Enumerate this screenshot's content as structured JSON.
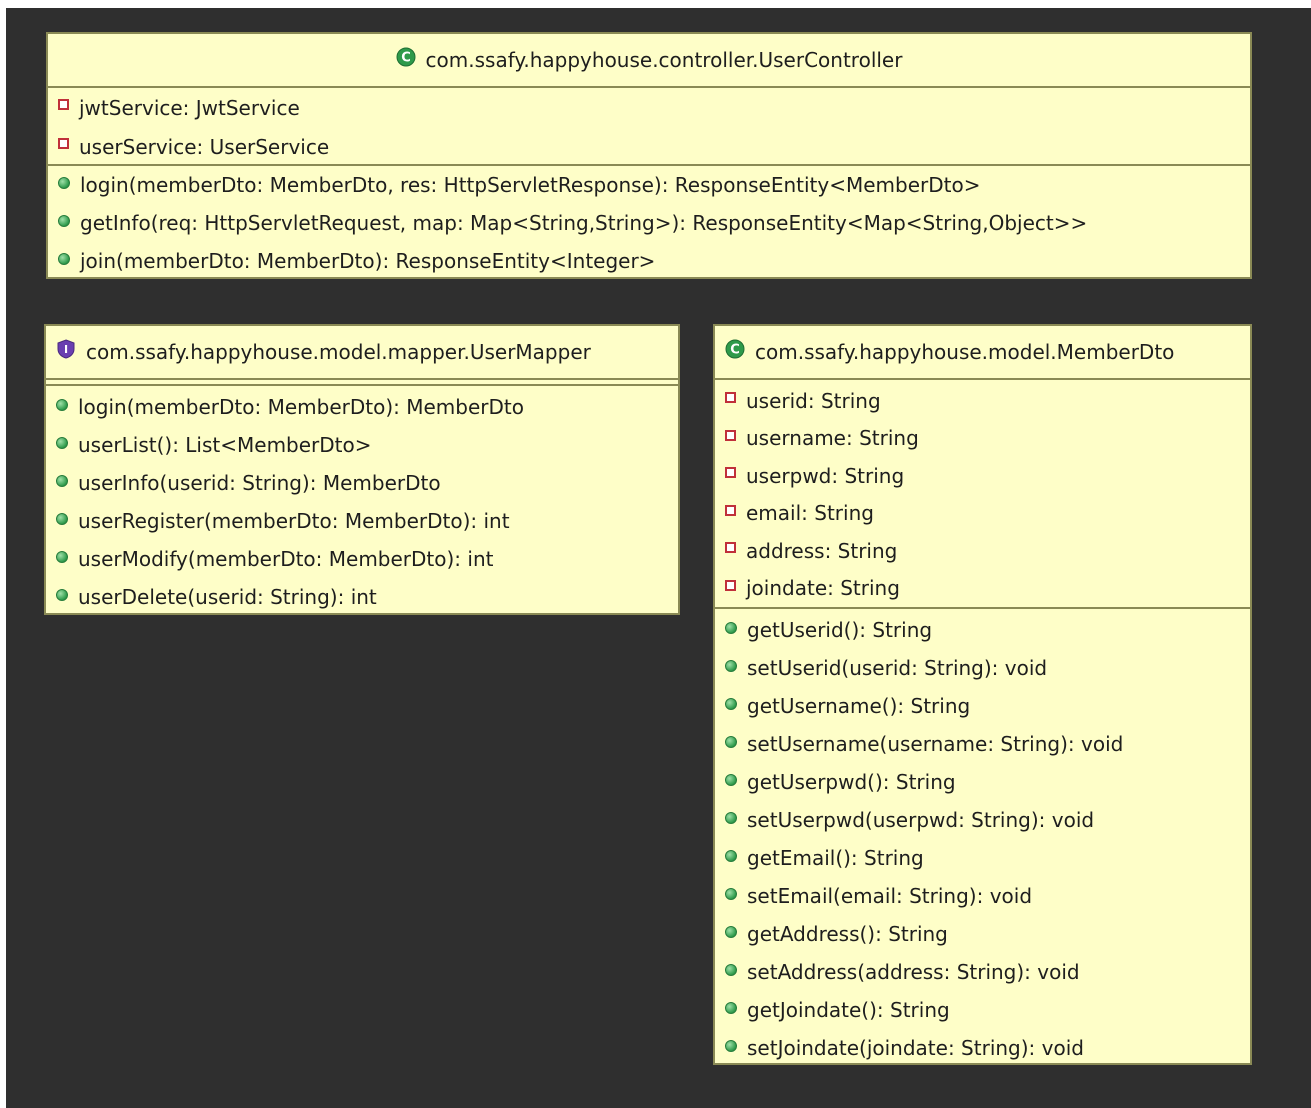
{
  "classes": {
    "user_controller": {
      "name": "com.ssafy.happyhouse.controller.UserController",
      "kind_icon": "class-icon",
      "fields": [
        "jwtService: JwtService",
        "userService: UserService"
      ],
      "methods": [
        "login(memberDto: MemberDto, res: HttpServletResponse): ResponseEntity<MemberDto>",
        "getInfo(req: HttpServletRequest, map: Map<String,String>): ResponseEntity<Map<String,Object>>",
        "join(memberDto: MemberDto): ResponseEntity<Integer>"
      ]
    },
    "user_mapper": {
      "name": "com.ssafy.happyhouse.model.mapper.UserMapper",
      "kind_icon": "interface-icon",
      "fields": [],
      "methods": [
        "login(memberDto: MemberDto): MemberDto",
        "userList(): List<MemberDto>",
        "userInfo(userid: String): MemberDto",
        "userRegister(memberDto: MemberDto): int",
        "userModify(memberDto: MemberDto): int",
        "userDelete(userid: String): int"
      ]
    },
    "member_dto": {
      "name": "com.ssafy.happyhouse.model.MemberDto",
      "kind_icon": "class-icon",
      "fields": [
        "userid: String",
        "username: String",
        "userpwd: String",
        "email: String",
        "address: String",
        "joindate: String"
      ],
      "methods": [
        "getUserid(): String",
        "setUserid(userid: String): void",
        "getUsername(): String",
        "setUsername(username: String): void",
        "getUserpwd(): String",
        "setUserpwd(userpwd: String): void",
        "getEmail(): String",
        "setEmail(email: String): void",
        "getAddress(): String",
        "setAddress(address: String): void",
        "getJoindate(): String",
        "setJoindate(joindate: String): void"
      ]
    }
  },
  "colors": {
    "canvas": "#2f2f2f",
    "box_fill": "#fefec8",
    "box_border": "#8a8a55",
    "private_icon": "#c0303a",
    "public_icon": "#2e9a4a",
    "class_icon": "#2e9a4a",
    "interface_icon": "#6a3fb0"
  }
}
